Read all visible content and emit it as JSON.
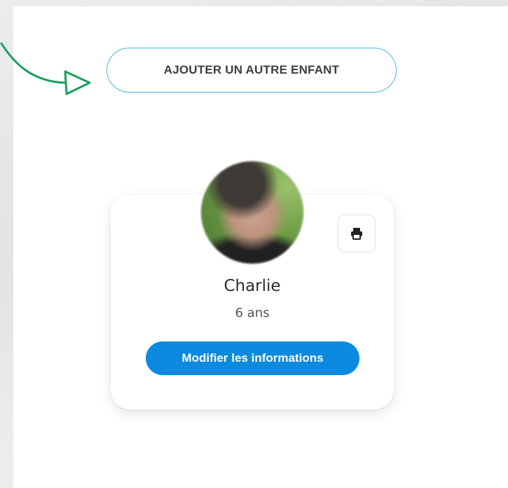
{
  "actions": {
    "add_child_label": "AJOUTER UN AUTRE ENFANT"
  },
  "child_card": {
    "name": "Charlie",
    "age": "6 ans",
    "edit_label": "Modifier les informations",
    "print_icon": "printer-icon",
    "avatar": "child-photo-blurred"
  },
  "colors": {
    "accent_blue": "#0b8ae0",
    "outline_blue": "#49b3e3",
    "annotation_green": "#1aa05a"
  }
}
